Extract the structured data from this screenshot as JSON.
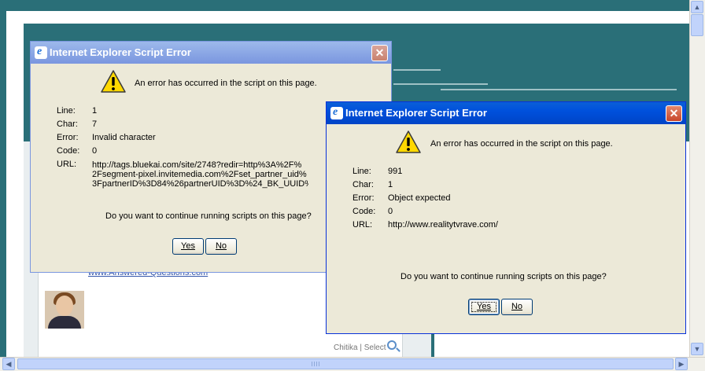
{
  "dialogs": [
    {
      "title": "Internet Explorer Script Error",
      "message": "An error has occurred in the script on this page.",
      "fields": {
        "line_label": "Line:",
        "line": "1",
        "char_label": "Char:",
        "char": "7",
        "error_label": "Error:",
        "error": "Invalid character",
        "code_label": "Code:",
        "code": "0",
        "url_label": "URL:",
        "url_lines": [
          "http://tags.bluekai.com/site/2748?redir=http%3A%2F%",
          "2Fsegment-pixel.invitemedia.com%2Fset_partner_uid%",
          "3FpartnerID%3D84%26partnerUID%3D%24_BK_UUID%"
        ]
      },
      "question": "Do you want to continue running scripts on this page?",
      "yes_label": "Yes",
      "no_label": "No",
      "close_symbol": "✕"
    },
    {
      "title": "Internet Explorer Script Error",
      "message": "An error has occurred in the script on this page.",
      "fields": {
        "line_label": "Line:",
        "line": "991",
        "char_label": "Char:",
        "char": "1",
        "error_label": "Error:",
        "error": "Object expected",
        "code_label": "Code:",
        "code": "0",
        "url_label": "URL:",
        "url": "http://www.realitytvrave.com/"
      },
      "question": "Do you want to continue running scripts on this page?",
      "yes_label": "Yes",
      "no_label": "No",
      "close_symbol": "✕"
    }
  ],
  "page": {
    "link_text": "www.Answered-Questions.com",
    "chitika": "Chitika | Select"
  },
  "icons": {
    "warning": "warning-icon",
    "ie": "internet-explorer-icon",
    "search": "magnifier-icon"
  },
  "colors": {
    "titlebar_active": "#0054e3",
    "dialog_face": "#ece9d8",
    "page_teal": "#2a6f78"
  }
}
